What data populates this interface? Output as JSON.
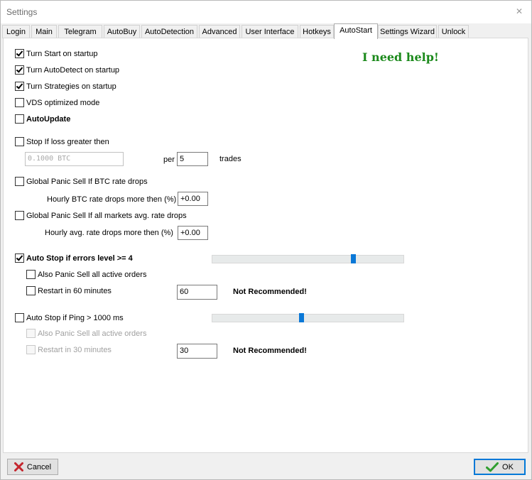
{
  "window": {
    "title": "Settings",
    "close_icon": "close-icon"
  },
  "tabs": [
    {
      "label": "Login"
    },
    {
      "label": "Main"
    },
    {
      "label": "Telegram"
    },
    {
      "label": "AutoBuy"
    },
    {
      "label": "AutoDetection"
    },
    {
      "label": "Advanced"
    },
    {
      "label": "User Interface"
    },
    {
      "label": "Hotkeys"
    },
    {
      "label": "AutoStart"
    },
    {
      "label": "Settings Wizard"
    },
    {
      "label": "Unlock"
    }
  ],
  "active_tab": "AutoStart",
  "help_link": "I need help!",
  "startup": {
    "turn_start": {
      "label": "Turn Start on startup",
      "checked": true
    },
    "turn_autodetect": {
      "label": "Turn AutoDetect on startup",
      "checked": true
    },
    "turn_strategies": {
      "label": "Turn Strategies on startup",
      "checked": true
    },
    "vds_mode": {
      "label": "VDS optimized mode",
      "checked": false
    },
    "autoupdate": {
      "label": "AutoUpdate",
      "checked": false
    }
  },
  "stop_loss": {
    "label": "Stop If loss greater then",
    "checked": false,
    "amount": "0.1000 BTC",
    "per_label": "per",
    "trades_value": "5",
    "trades_label": "trades"
  },
  "panic_btc": {
    "label": "Global Panic Sell If BTC rate drops",
    "checked": false,
    "hourly_label": "Hourly BTC rate drops more then (%)",
    "hourly_value": "+0.00"
  },
  "panic_markets": {
    "label": "Global Panic Sell If all markets avg. rate drops",
    "checked": false,
    "hourly_label": "Hourly avg. rate drops more then (%)",
    "hourly_value": "+0.00"
  },
  "auto_stop_errors": {
    "label": "Auto Stop if errors level >= 4",
    "checked": true,
    "slider_fraction": 0.74,
    "panic_sell": {
      "label": "Also Panic Sell all active orders",
      "checked": false
    },
    "restart": {
      "label": "Restart in 60 minutes",
      "checked": false
    },
    "restart_value": "60",
    "warning": "Not Recommended!"
  },
  "auto_stop_ping": {
    "label": "Auto Stop if Ping > 1000 ms",
    "checked": false,
    "slider_fraction": 0.47,
    "panic_sell": {
      "label": "Also Panic Sell all active orders",
      "checked": false
    },
    "restart": {
      "label": "Restart in 30 minutes",
      "checked": false
    },
    "restart_value": "30",
    "warning": "Not Recommended!"
  },
  "buttons": {
    "cancel": {
      "label": "Cancel",
      "icon": "x-icon",
      "icon_color": "#c4262e"
    },
    "ok": {
      "label": "OK",
      "icon": "checkmark-icon",
      "icon_color": "#2f9e2f"
    }
  },
  "colors": {
    "accent": "#0078d7",
    "help_green": "#1c8a1c"
  }
}
